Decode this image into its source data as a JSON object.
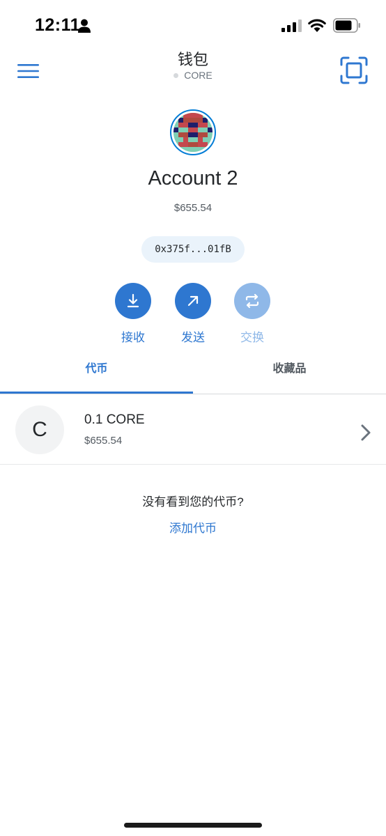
{
  "status_bar": {
    "time": "12:11",
    "icons": [
      "person-icon",
      "signal-icon",
      "wifi-icon",
      "battery-icon"
    ]
  },
  "header": {
    "title": "钱包",
    "network": "CORE",
    "left_icon": "menu-icon",
    "right_icon": "scan-icon"
  },
  "account": {
    "name": "Account 2",
    "balance": "$655.54",
    "address": "0x375f...01fB"
  },
  "actions": {
    "receive": "接收",
    "send": "发送",
    "swap": "交换"
  },
  "tabs": {
    "tokens": "代币",
    "collectibles": "收藏品"
  },
  "tokens": [
    {
      "symbol_letter": "C",
      "amount": "0.1 CORE",
      "fiat": "$655.54"
    }
  ],
  "footer": {
    "no_token_text": "没有看到您的代币?",
    "add_token": "添加代币"
  },
  "colors": {
    "accent": "#2e77d0",
    "accent_disabled": "#8fb8e8",
    "address_bg": "#eaf3fb",
    "text_primary": "#24272a",
    "text_secondary": "#535a61"
  }
}
